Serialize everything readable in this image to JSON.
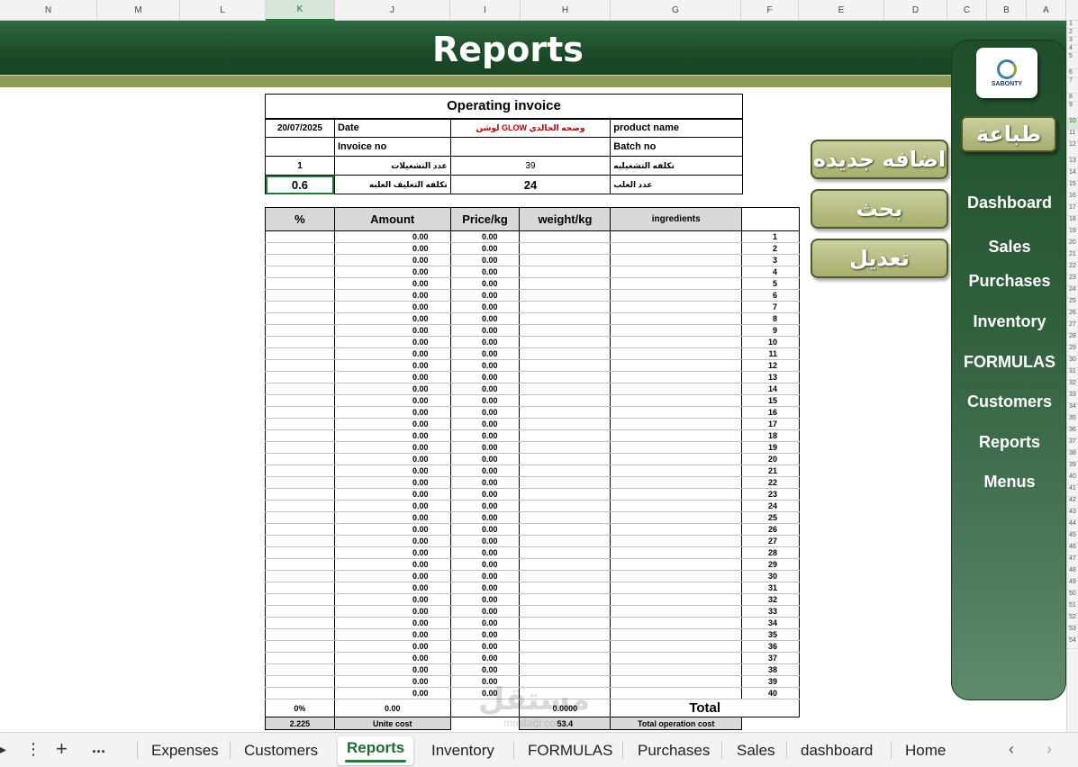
{
  "columns": [
    "N",
    "M",
    "L",
    "K",
    "J",
    "I",
    "H",
    "G",
    "F",
    "E",
    "D",
    "C",
    "B",
    "A"
  ],
  "selected_column": "K",
  "banner": {
    "title": "Reports"
  },
  "invoice": {
    "title": "Operating invoice",
    "date_value": "20/07/2025",
    "date_label": "Date",
    "product_name_value": "لوشن GLOW وضحه الحالدي",
    "product_name_label": "product name",
    "invoice_no_label": "Invoice no",
    "invoice_no_value": "",
    "batch_no_label": "Batch no",
    "batch_no_value": "",
    "operations_count_value": "1",
    "operations_count_label": "عدد التشغيلات",
    "operating_cost_value": "39",
    "operating_cost_label": "تكلفه التشغيليه",
    "packaging_cost_value": "0.6",
    "packaging_cost_label": "تكلفه التغليف  العلبه",
    "cans_count_value": "24",
    "cans_count_label": "عدد العلب"
  },
  "table": {
    "headers": {
      "percent": "%",
      "amount": "Amount",
      "price": "Price/kg",
      "weight": "weight/kg",
      "ingredients": "ingredients"
    },
    "rows": [
      {
        "amount": "0.00",
        "price": "0.00",
        "n": "1"
      },
      {
        "amount": "0.00",
        "price": "0.00",
        "n": "2"
      },
      {
        "amount": "0.00",
        "price": "0.00",
        "n": "3"
      },
      {
        "amount": "0.00",
        "price": "0.00",
        "n": "4"
      },
      {
        "amount": "0.00",
        "price": "0.00",
        "n": "5"
      },
      {
        "amount": "0.00",
        "price": "0.00",
        "n": "6"
      },
      {
        "amount": "0.00",
        "price": "0.00",
        "n": "7"
      },
      {
        "amount": "0.00",
        "price": "0.00",
        "n": "8"
      },
      {
        "amount": "0.00",
        "price": "0.00",
        "n": "9"
      },
      {
        "amount": "0.00",
        "price": "0.00",
        "n": "10"
      },
      {
        "amount": "0.00",
        "price": "0.00",
        "n": "11"
      },
      {
        "amount": "0.00",
        "price": "0.00",
        "n": "12"
      },
      {
        "amount": "0.00",
        "price": "0.00",
        "n": "13"
      },
      {
        "amount": "0.00",
        "price": "0.00",
        "n": "14"
      },
      {
        "amount": "0.00",
        "price": "0.00",
        "n": "15"
      },
      {
        "amount": "0.00",
        "price": "0.00",
        "n": "16"
      },
      {
        "amount": "0.00",
        "price": "0.00",
        "n": "17"
      },
      {
        "amount": "0.00",
        "price": "0.00",
        "n": "18"
      },
      {
        "amount": "0.00",
        "price": "0.00",
        "n": "19"
      },
      {
        "amount": "0.00",
        "price": "0.00",
        "n": "20"
      },
      {
        "amount": "0.00",
        "price": "0.00",
        "n": "21"
      },
      {
        "amount": "0.00",
        "price": "0.00",
        "n": "22"
      },
      {
        "amount": "0.00",
        "price": "0.00",
        "n": "23"
      },
      {
        "amount": "0.00",
        "price": "0.00",
        "n": "24"
      },
      {
        "amount": "0.00",
        "price": "0.00",
        "n": "25"
      },
      {
        "amount": "0.00",
        "price": "0.00",
        "n": "26"
      },
      {
        "amount": "0.00",
        "price": "0.00",
        "n": "27"
      },
      {
        "amount": "0.00",
        "price": "0.00",
        "n": "28"
      },
      {
        "amount": "0.00",
        "price": "0.00",
        "n": "29"
      },
      {
        "amount": "0.00",
        "price": "0.00",
        "n": "30"
      },
      {
        "amount": "0.00",
        "price": "0.00",
        "n": "31"
      },
      {
        "amount": "0.00",
        "price": "0.00",
        "n": "32"
      },
      {
        "amount": "0.00",
        "price": "0.00",
        "n": "33"
      },
      {
        "amount": "0.00",
        "price": "0.00",
        "n": "34"
      },
      {
        "amount": "0.00",
        "price": "0.00",
        "n": "35"
      },
      {
        "amount": "0.00",
        "price": "0.00",
        "n": "36"
      },
      {
        "amount": "0.00",
        "price": "0.00",
        "n": "37"
      },
      {
        "amount": "0.00",
        "price": "0.00",
        "n": "38"
      },
      {
        "amount": "0.00",
        "price": "0.00",
        "n": "39"
      },
      {
        "amount": "0.00",
        "price": "0.00",
        "n": "40"
      }
    ],
    "totals": {
      "percent": "0%",
      "amount": "0.00",
      "weight": "0.0000",
      "total_label": "Total"
    },
    "summary": {
      "unit_cost_value": "2.225",
      "unit_cost_label": "Unite cost",
      "total_op_value": "53.4",
      "total_op_label": "Total operation cost"
    }
  },
  "actions": {
    "add_new": "اضافه جديده",
    "search": "بحث",
    "edit": "تعديل"
  },
  "sidebar": {
    "logo_text": "SABONTY",
    "print": "طباعة",
    "items": [
      "Dashboard",
      "Sales",
      "Purchases",
      "Inventory",
      "FORMULAS",
      "Customers",
      "Reports",
      "Menus"
    ]
  },
  "tabs": {
    "overflow": "...",
    "items": [
      "Expenses",
      "Customers",
      "Reports",
      "Inventory",
      "FORMULAS",
      "Purchases",
      "Sales",
      "dashboard",
      "Home"
    ],
    "active": "Reports"
  },
  "watermark": {
    "arabic": "مستقل",
    "latin": "mostaql.com"
  },
  "row_numbers": [
    "1",
    "2",
    "3",
    "4",
    "5",
    "6",
    "7",
    "8",
    "9",
    "10",
    "11",
    "12",
    "13",
    "14",
    "15",
    "16",
    "17",
    "18",
    "19",
    "20",
    "21",
    "22",
    "23",
    "24",
    "25",
    "26",
    "27",
    "28",
    "29",
    "30",
    "31",
    "32",
    "33",
    "34",
    "35",
    "36",
    "37",
    "38",
    "39",
    "40",
    "41",
    "42",
    "43",
    "44",
    "45",
    "46",
    "47",
    "48",
    "49",
    "50",
    "51",
    "52",
    "53",
    "54"
  ],
  "selected_row": "10"
}
